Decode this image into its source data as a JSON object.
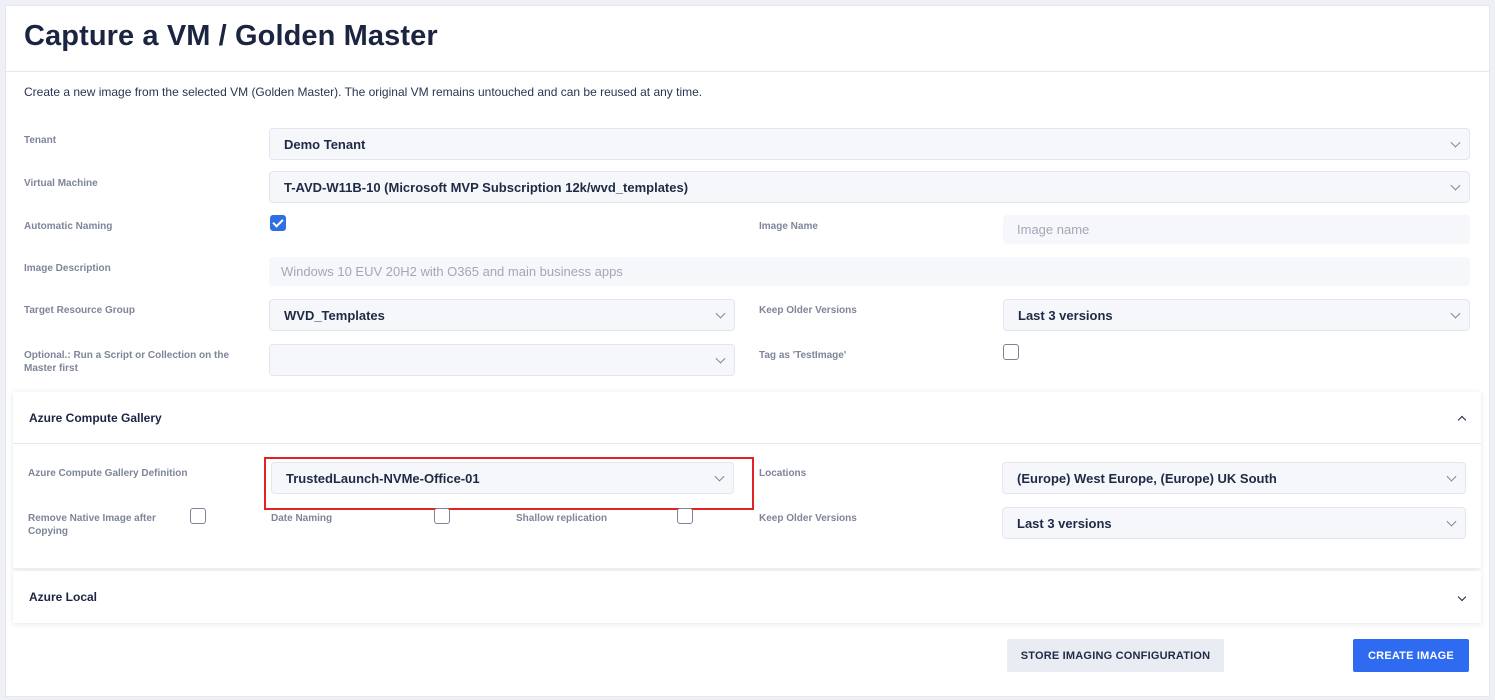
{
  "header": {
    "title": "Capture a VM / Golden Master"
  },
  "description": "Create a new image from the selected VM (Golden Master). The original VM remains untouched and can be reused at any time.",
  "form": {
    "tenant": {
      "label": "Tenant",
      "value": "Demo Tenant"
    },
    "virtual_machine": {
      "label": "Virtual Machine",
      "value": "T-AVD-W11B-10 (Microsoft MVP Subscription 12k/wvd_templates)"
    },
    "automatic_naming": {
      "label": "Automatic Naming",
      "checked": true
    },
    "image_name": {
      "label": "Image Name",
      "placeholder": "Image name"
    },
    "image_description": {
      "label": "Image Description",
      "placeholder": "Windows 10 EUV 20H2 with O365 and main business apps"
    },
    "target_resource_group": {
      "label": "Target Resource Group",
      "value": "WVD_Templates"
    },
    "keep_older_versions": {
      "label": "Keep Older Versions",
      "value": "Last 3 versions"
    },
    "run_script": {
      "label": "Optional.: Run a Script or Collection on the Master first",
      "value": ""
    },
    "tag_test_image": {
      "label": "Tag as 'TestImage'",
      "checked": false
    }
  },
  "gallery_panel": {
    "title": "Azure Compute Gallery",
    "expanded": true,
    "definition": {
      "label": "Azure Compute Gallery Definition",
      "value": "TrustedLaunch-NVMe-Office-01"
    },
    "locations": {
      "label": "Locations",
      "value": "(Europe) West Europe, (Europe) UK South"
    },
    "remove_native": {
      "label": "Remove Native Image after Copying",
      "checked": false
    },
    "date_naming": {
      "label": "Date Naming",
      "checked": false
    },
    "shallow_replication": {
      "label": "Shallow replication",
      "checked": false
    },
    "keep_older_versions": {
      "label": "Keep Older Versions",
      "value": "Last 3 versions"
    }
  },
  "local_panel": {
    "title": "Azure Local",
    "expanded": false
  },
  "actions": {
    "store_label": "STORE IMAGING CONFIGURATION",
    "create_label": "CREATE IMAGE"
  },
  "colors": {
    "accent": "#2f6bf0",
    "highlight": "#e02424"
  },
  "icons": [
    "chevron-down-icon",
    "chevron-up-icon",
    "checkmark-icon"
  ]
}
